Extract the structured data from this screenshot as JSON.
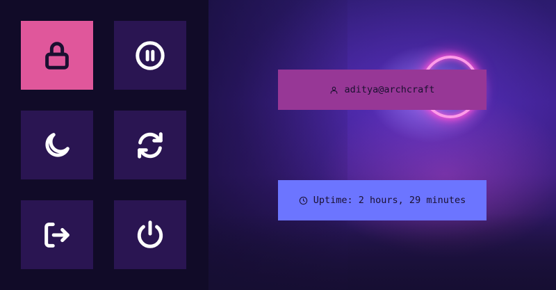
{
  "colors": {
    "sidebar_bg": "#110b28",
    "tile_bg": "#2a1552",
    "tile_active_bg": "#e0579b",
    "icon_color": "#ffffff",
    "icon_active_color": "#1a1030",
    "user_card_bg": "#973796",
    "uptime_card_bg": "#6c75ff"
  },
  "actions": [
    {
      "icon": "lock-icon",
      "name": "lock",
      "active": true
    },
    {
      "icon": "pause-icon",
      "name": "suspend",
      "active": false
    },
    {
      "icon": "moon-icon",
      "name": "hibernate",
      "active": false
    },
    {
      "icon": "refresh-icon",
      "name": "reboot",
      "active": false
    },
    {
      "icon": "logout-icon",
      "name": "logout",
      "active": false
    },
    {
      "icon": "power-icon",
      "name": "shutdown",
      "active": false
    }
  ],
  "user_card": {
    "icon": "user-icon",
    "text": "aditya@archcraft"
  },
  "uptime_card": {
    "icon": "clock-icon",
    "text": "Uptime: 2 hours, 29 minutes"
  }
}
